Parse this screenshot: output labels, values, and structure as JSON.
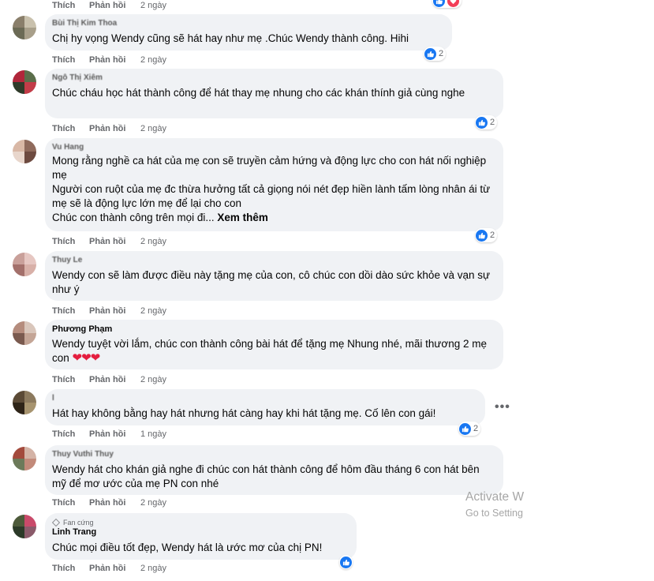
{
  "actions": {
    "like": "Thích",
    "reply": "Phản hồi",
    "time": "2 ngày",
    "time_alt": "1 ngày"
  },
  "top_row": {
    "like": "Thích",
    "reply": "Phản hồi",
    "time": "2 ngày"
  },
  "comments": [
    {
      "author": "Bùi Thị Kim Thoa",
      "text": "Chị hy vọng Wendy cũng sẽ hát hay như mẹ .Chúc Wendy thành công. Hihi",
      "time": "2 ngày",
      "reactions": "2"
    },
    {
      "author": "Ngô Thị Xiêm",
      "text": "Chúc cháu học hát thành công để hát thay mẹ nhung cho các khán thính giả cùng nghe",
      "time": "2 ngày",
      "reactions": "2"
    },
    {
      "author": "Vu Hang",
      "text": "Mong rằng nghề ca hát của mẹ con sẽ truyền cảm hứng và động lực cho con hát nối nghiệp mẹ",
      "text2": "Người con ruột của mẹ đc thừa hưởng tất cả giọng nói nét đẹp hiền lành tấm lòng nhân ái từ mẹ sẽ là động lực lớn mẹ để lại cho con",
      "text3": "Chúc con thành công trên mọi đi...",
      "more": "Xem thêm",
      "time": "2 ngày",
      "reactions": "2"
    },
    {
      "author": "Thuy Le",
      "text": "Wendy con sẽ làm được điều này tặng mẹ của con, cô chúc con dồi dào sức khỏe và vạn sự như ý",
      "time": "2 ngày"
    },
    {
      "author": "Phương Phạm",
      "text": "Wendy tuyệt vời lắm, chúc con thành công bài hát để tặng mẹ Nhung nhé, mãi thương 2 mẹ con",
      "hearts": "❤❤❤",
      "time": "2 ngày"
    },
    {
      "author": "l",
      "text": "Hát hay không bằng hay hát nhưng hát càng hay khi hát tặng mẹ. Cố lên con gái!",
      "time": "1 ngày",
      "reactions": "2"
    },
    {
      "author": "Thuy Vuthi Thuy",
      "text": "Wendy hát cho khán giả nghe đi chúc con hát thành công để hôm đầu tháng 6 con hát bên mỹ để mơ ước của mẹ PN con nhé",
      "time": "2 ngày"
    },
    {
      "badge": "Fan cứng",
      "author": "Linh Trang",
      "text": "Chúc mọi điều tốt đẹp, Wendy hát là ước mơ của chị PN!",
      "time": "2 ngày",
      "reactions": ""
    }
  ],
  "watermark": {
    "line1": "Activate W",
    "line2": "Go to Setting"
  },
  "colors": {
    "bubble": "#f0f2f5",
    "like_blue": "#1877f2",
    "meta": "#65676b",
    "heart": "#e41e3f"
  },
  "icons": [
    "like-reaction-icon",
    "heart-icon",
    "more-options-icon",
    "fan-badge-icon"
  ]
}
